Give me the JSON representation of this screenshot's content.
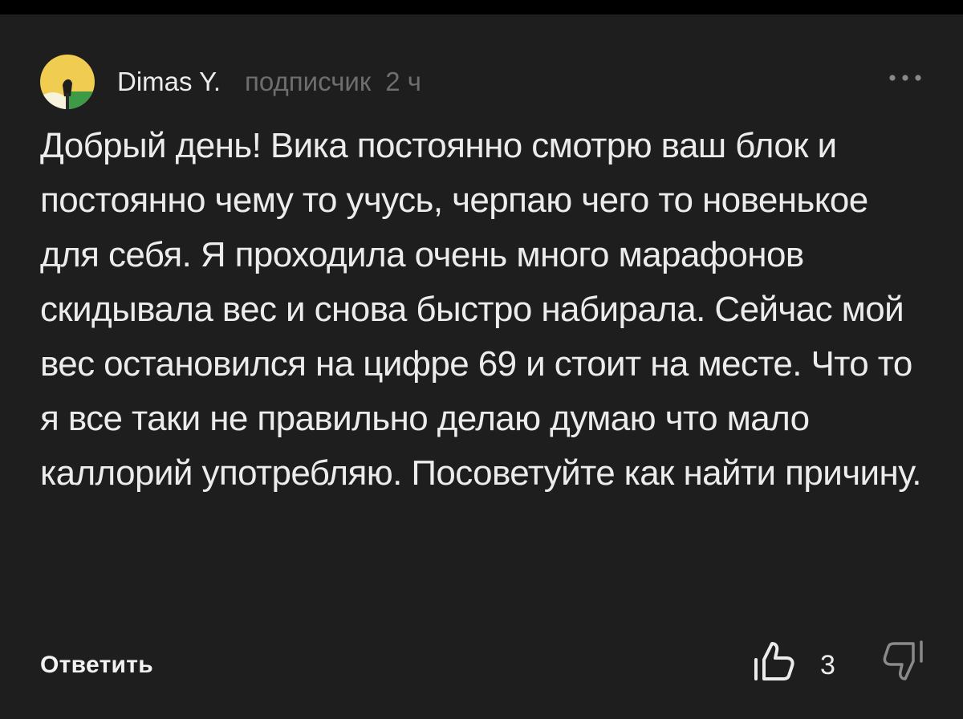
{
  "comment": {
    "author": {
      "name": "Dimas Y.",
      "badge": "подписчик",
      "time_ago": "2 ч",
      "avatar_icon": "flower-avatar-icon"
    },
    "text": "Добрый день! Вика постоянно смотрю  ваш блок и постоянно чему то учусь, черпаю чего то новенькое для себя. Я проходила очень много марафонов скидывала вес и снова быстро набирала. Сейчас мой вес остановился на цифре 69 и стоит на месте. Что то я все таки не правильно делаю думаю что мало каллорий употребляю. Посоветуйте как найти причину.",
    "actions": {
      "reply_label": "Ответить",
      "like_count": "3",
      "more_icon": "more-dots-icon",
      "like_icon": "thumbs-up-icon",
      "dislike_icon": "thumbs-down-icon"
    }
  },
  "colors": {
    "background": "#1e1e1f",
    "text_primary": "#ececec",
    "text_secondary": "#6e6e6f",
    "avatar_yellow": "#f0cc50",
    "avatar_green": "#3f9a48"
  }
}
